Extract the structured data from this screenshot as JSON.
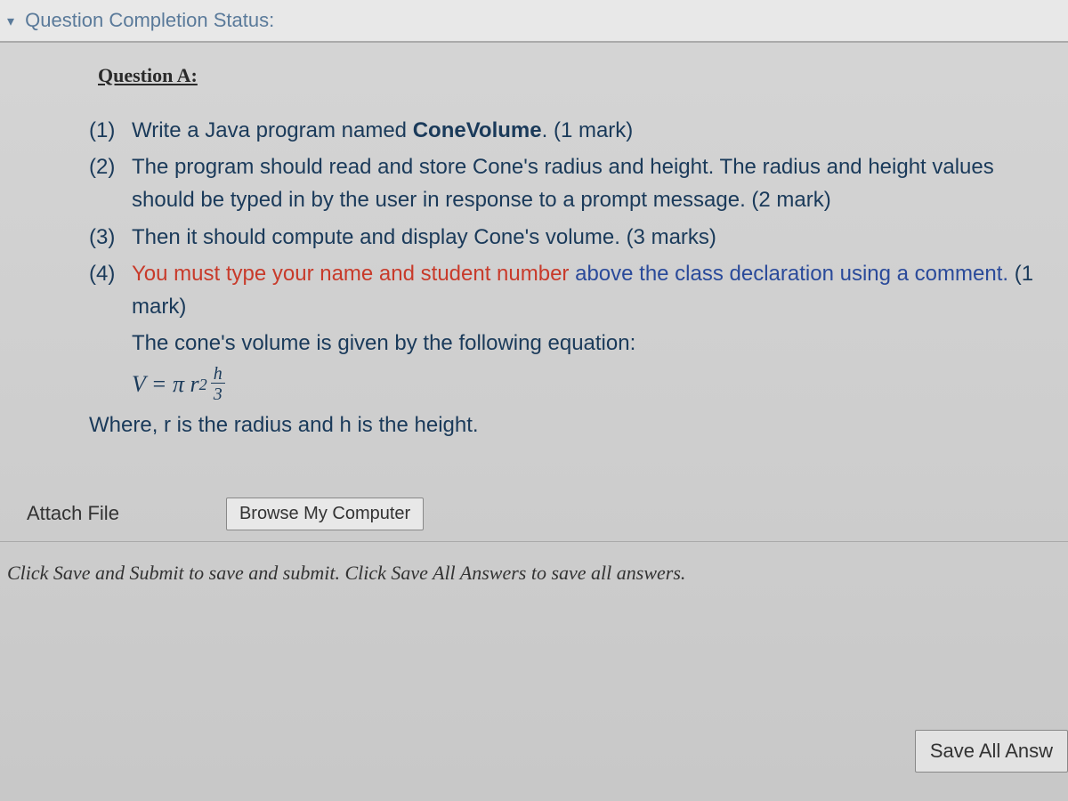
{
  "statusBar": {
    "label": "Question Completion Status:"
  },
  "question": {
    "heading": "Question A:",
    "items": [
      {
        "num": "(1)",
        "prefix": "Write a Java program named ",
        "bold": "ConeVolume",
        "suffix": ". (1 mark)"
      },
      {
        "num": "(2)",
        "text": "The program should read and store Cone's radius and height. The radius and height values should be typed in by the user in response to a prompt message. (2 mark)"
      },
      {
        "num": "(3)",
        "text": "Then it should compute and display Cone's volume. (3 marks)"
      },
      {
        "num": "(4)",
        "red": "You must type your name and student number ",
        "blue": "above the class declaration using a comment.",
        "suffix": " (1 mark)"
      }
    ],
    "equationIntro": "The cone's volume is given by the following equation:",
    "formula": {
      "left": "V = π r",
      "exp": "2",
      "fracTop": "h",
      "fracBot": "3"
    },
    "where": "Where, r is the radius and h is the height."
  },
  "attach": {
    "label": "Attach File",
    "browse": "Browse My Computer"
  },
  "hint": "Click Save and Submit to save and submit. Click Save All Answers to save all answers.",
  "buttons": {
    "saveAll": "Save All Answ"
  }
}
